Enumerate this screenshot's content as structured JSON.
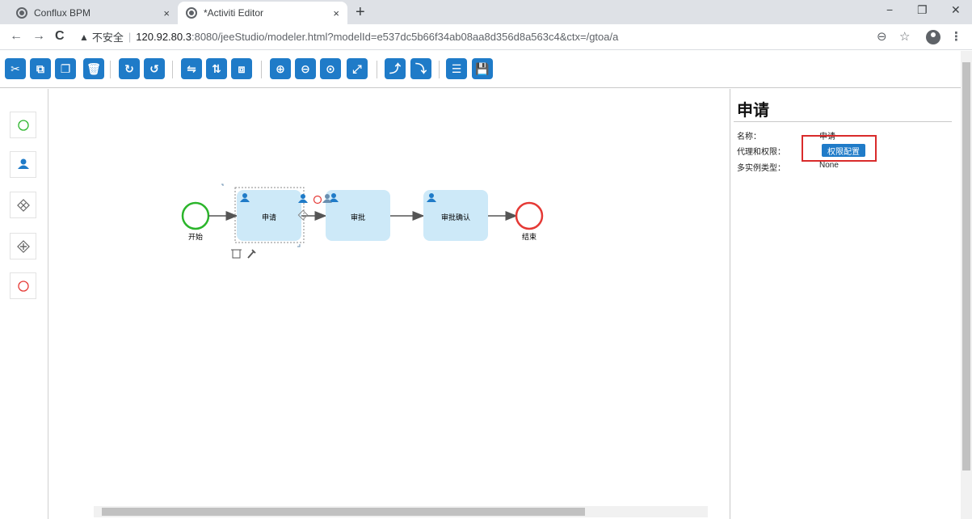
{
  "browser": {
    "tabs": [
      {
        "title": "Conflux BPM",
        "active": false
      },
      {
        "title": "*Activiti Editor",
        "active": true
      }
    ],
    "tab_close": "×",
    "new_tab": "+",
    "window_controls": [
      "−",
      "❐",
      "✕"
    ],
    "nav": {
      "back": "←",
      "forward": "→",
      "reload": "C"
    },
    "address": {
      "security_icon": "warning-triangle-icon",
      "security_text": "不安全",
      "separator": "|",
      "host": "120.92.80.3",
      "path": ":8080/jeeStudio/modeler.html?modelId=e537dc5b66f34ab08aa8d356d8a563c4&ctx=/gtoa/a"
    },
    "right_icons": [
      "zoom-icon",
      "star-icon",
      "account-icon",
      "menu-icon"
    ]
  },
  "toolbar": {
    "buttons": [
      {
        "name": "cut-button",
        "glyph": "✂"
      },
      {
        "name": "copy-button",
        "glyph": "⧉"
      },
      {
        "name": "paste-button",
        "glyph": "❐"
      },
      {
        "name": "delete-button",
        "glyph": "🗑"
      },
      {
        "name": "redo-button",
        "glyph": "↻"
      },
      {
        "name": "undo-button",
        "glyph": "↺"
      },
      {
        "name": "align-horizontal-button",
        "glyph": "⇋"
      },
      {
        "name": "align-vertical-button",
        "glyph": "⇅"
      },
      {
        "name": "same-size-button",
        "glyph": "⧈"
      },
      {
        "name": "zoom-in-button",
        "glyph": "⊕"
      },
      {
        "name": "zoom-out-button",
        "glyph": "⊖"
      },
      {
        "name": "zoom-actual-button",
        "glyph": "⊙"
      },
      {
        "name": "zoom-fit-button",
        "glyph": "⤢"
      },
      {
        "name": "bendpoint-add-button",
        "glyph": "⤴"
      },
      {
        "name": "bendpoint-remove-button",
        "glyph": "⤵"
      },
      {
        "name": "view-xml-button",
        "glyph": "☰"
      },
      {
        "name": "save-button",
        "glyph": "💾"
      }
    ]
  },
  "palette": {
    "items": [
      "start-event-icon",
      "user-task-icon",
      "exclusive-gateway-icon",
      "parallel-gateway-icon",
      "end-event-icon"
    ]
  },
  "diagram": {
    "start_label": "开始",
    "end_label": "结束",
    "tasks": [
      {
        "label": "申请",
        "selected": true
      },
      {
        "label": "审批",
        "selected": false
      },
      {
        "label": "审批确认",
        "selected": false
      }
    ],
    "colors": {
      "task_fill": "#cde9f8",
      "start_stroke": "#2bb52b",
      "end_stroke": "#e53935",
      "accent": "#1f7bc8"
    }
  },
  "properties": {
    "title": "申请",
    "rows": [
      {
        "label": "名称：",
        "value": "申请"
      },
      {
        "label": "代理和权限：",
        "button": "权限配置"
      },
      {
        "label": "多实例类型：",
        "value": "None"
      }
    ]
  }
}
